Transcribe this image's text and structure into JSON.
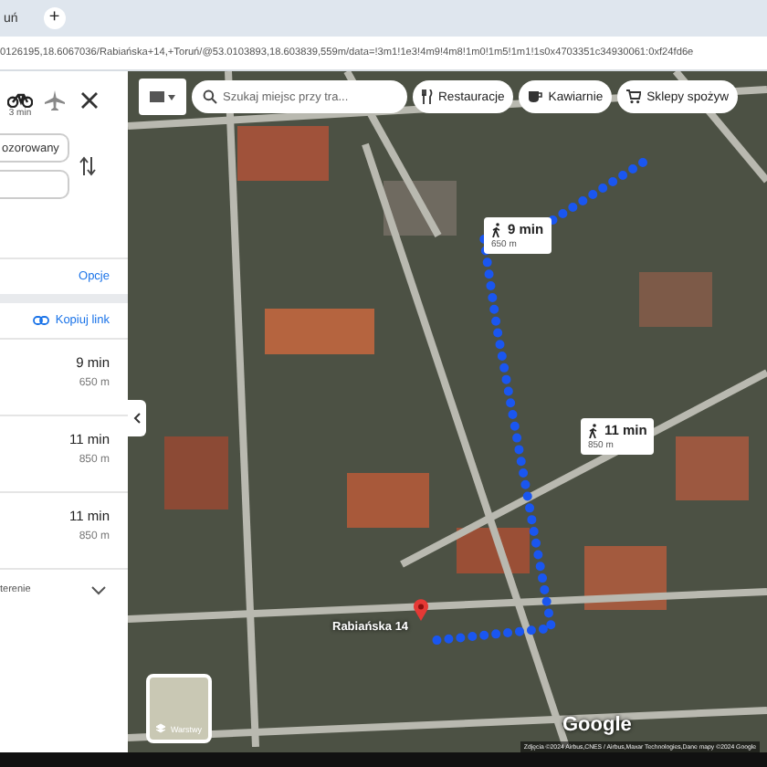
{
  "browser": {
    "tab_title": "uń",
    "new_tab": "+",
    "url": "0126195,18.6067036/Rabiańska+14,+Toruń/@53.0103893,18.603839,559m/data=!3m1!1e3!4m9!4m8!1m0!1m5!1m1!1s0x4703351c34930061:0xf24fd6e"
  },
  "directions": {
    "modes": [
      {
        "kind": "bicycle",
        "time": "3 min",
        "selected": true
      },
      {
        "kind": "plane",
        "selected": false
      }
    ],
    "origin": {
      "value": "ozorowany"
    },
    "options_link": "Opcje",
    "copy_link": "Kopiuj link",
    "routes": [
      {
        "time": "9 min",
        "distance": "650 m"
      },
      {
        "time": "11 min",
        "distance": "850 m"
      },
      {
        "time": "11 min",
        "distance": "850 m"
      }
    ],
    "terrain_toggle": "terenie"
  },
  "map": {
    "search": {
      "placeholder": "Szukaj miejsc przy tra..."
    },
    "chips": [
      {
        "kind": "restaurant",
        "label": "Restauracje"
      },
      {
        "kind": "cafe",
        "label": "Kawiarnie"
      },
      {
        "kind": "shop",
        "label": "Sklepy spożyw"
      }
    ],
    "route_bubbles": [
      {
        "time": "9 min",
        "distance": "650 m"
      },
      {
        "time": "11 min",
        "distance": "850 m"
      }
    ],
    "pin_label": "Rabiańska 14",
    "layers_button": "Warstwy",
    "logo": "Google",
    "attribution": "Zdjęcia ©2024 Airbus,CNES / Airbus,Maxar Technologies,Dane mapy ©2024 Google"
  }
}
